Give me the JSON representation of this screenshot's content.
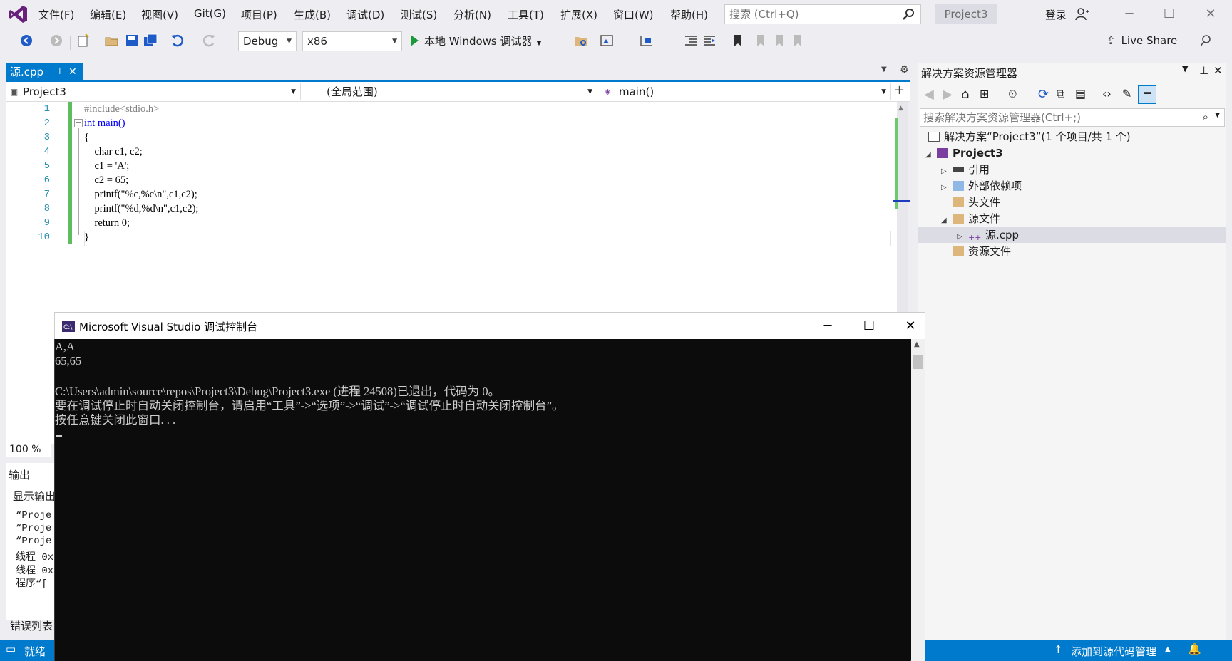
{
  "menubar": {
    "items": [
      "文件(F)",
      "编辑(E)",
      "视图(V)",
      "Git(G)",
      "项目(P)",
      "生成(B)",
      "调试(D)",
      "测试(S)",
      "分析(N)",
      "工具(T)",
      "扩展(X)",
      "窗口(W)",
      "帮助(H)"
    ],
    "search_placeholder": "搜索 (Ctrl+Q)",
    "project_badge": "Project3",
    "login_label": "登录"
  },
  "toolbar": {
    "config": "Debug",
    "platform": "x86",
    "run_label": "本地 Windows 调试器",
    "liveshare_label": "Live Share"
  },
  "editor": {
    "tab_label": "源.cpp",
    "nav_project": "Project3",
    "nav_scope": "(全局范围)",
    "nav_member": "main()",
    "zoom": "100 %",
    "line_numbers": [
      "1",
      "2",
      "3",
      "4",
      "5",
      "6",
      "7",
      "8",
      "9",
      "10"
    ],
    "lines": [
      "#include<stdio.h>",
      "int main()",
      "{",
      "    char c1, c2;",
      "    c1 = 'A';",
      "    c2 = 65;",
      "    printf(\"%c,%c\\n\",c1,c2);",
      "    printf(\"%d,%d\\n\",c1,c2);",
      "    return 0;",
      "}"
    ]
  },
  "output_panel": {
    "title": "输出",
    "show_label": "显示输出",
    "lines": [
      "“Proje",
      "“Proje",
      "“Proje",
      "线程 0x",
      "线程 0x",
      "程序“["
    ],
    "error_list_label": "错误列表"
  },
  "solution_explorer": {
    "title": "解决方案资源管理器",
    "search_placeholder": "搜索解决方案资源管理器(Ctrl+;)",
    "tree": [
      {
        "label": "解决方案“Project3”(1 个项目/共 1 个)",
        "indent": 0,
        "arrow": ""
      },
      {
        "label": "Project3",
        "indent": 1,
        "arrow": "◢"
      },
      {
        "label": "引用",
        "indent": 2,
        "arrow": "▷"
      },
      {
        "label": "外部依赖项",
        "indent": 2,
        "arrow": "▷"
      },
      {
        "label": "头文件",
        "indent": 2,
        "arrow": ""
      },
      {
        "label": "源文件",
        "indent": 2,
        "arrow": "◢"
      },
      {
        "label": "源.cpp",
        "indent": 3,
        "arrow": "▷"
      },
      {
        "label": "资源文件",
        "indent": 2,
        "arrow": ""
      }
    ]
  },
  "statusbar": {
    "ready": "就绪",
    "source_control": "添加到源代码管理"
  },
  "console": {
    "title": "Microsoft Visual Studio 调试控制台",
    "lines": [
      "A,A",
      "65,65",
      "",
      "C:\\Users\\admin\\source\\repos\\Project3\\Debug\\Project3.exe (进程 24508)已退出，代码为 0。",
      "要在调试停止时自动关闭控制台，请启用“工具”->“选项”->“调试”->“调试停止时自动关闭控制台”。",
      "按任意键关闭此窗口. . ."
    ]
  },
  "colors": {
    "accent": "#007acc",
    "console_bg": "#0c0c0c",
    "run_green": "#1c9a3a"
  }
}
